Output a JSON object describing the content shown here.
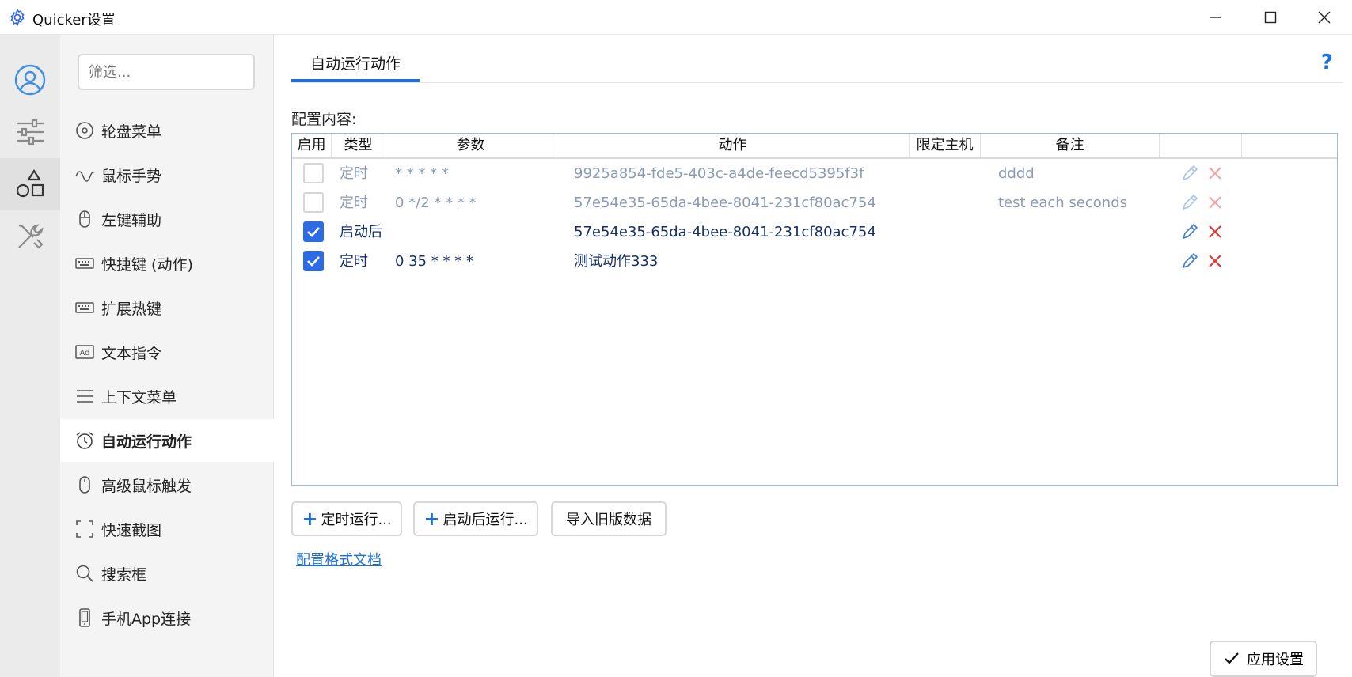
{
  "window": {
    "title": "Quicker设置"
  },
  "rail": {
    "items": [
      {
        "icon": "user-icon"
      },
      {
        "icon": "sliders-icon"
      },
      {
        "icon": "shapes-icon"
      },
      {
        "icon": "tools-icon"
      }
    ]
  },
  "nav": {
    "filter_placeholder": "筛选...",
    "items": [
      {
        "label": "轮盘菜单",
        "icon": "circle-dot-icon"
      },
      {
        "label": "鼠标手势",
        "icon": "wave-icon"
      },
      {
        "label": "左键辅助",
        "icon": "mouse-icon"
      },
      {
        "label": "快捷键 (动作)",
        "icon": "keyboard-icon"
      },
      {
        "label": "扩展热键",
        "icon": "keyboard-icon"
      },
      {
        "label": "文本指令",
        "icon": "ad-text-icon"
      },
      {
        "label": "上下文菜单",
        "icon": "menu-lines-icon"
      },
      {
        "label": "自动运行动作",
        "icon": "alarm-clock-icon",
        "active": true
      },
      {
        "label": "高级鼠标触发",
        "icon": "mouse-icon"
      },
      {
        "label": "快速截图",
        "icon": "screenshot-icon"
      },
      {
        "label": "搜索框",
        "icon": "search-icon"
      },
      {
        "label": "手机App连接",
        "icon": "phone-icon"
      }
    ]
  },
  "main": {
    "tab_label": "自动运行动作",
    "help": "?",
    "section_label": "配置内容:",
    "columns": [
      "启用",
      "类型",
      "参数",
      "动作",
      "限定主机",
      "备注"
    ],
    "rows": [
      {
        "enabled": false,
        "type": "定时",
        "params": "* * * * *",
        "action": "9925a854-fde5-403c-a4de-feecd5395f3f",
        "host": "",
        "note": "dddd"
      },
      {
        "enabled": false,
        "type": "定时",
        "params": "0 */2 * * * *",
        "action": "57e54e35-65da-4bee-8041-231cf80ac754",
        "host": "",
        "note": "test each seconds"
      },
      {
        "enabled": true,
        "type": "启动后",
        "params": "",
        "action": "57e54e35-65da-4bee-8041-231cf80ac754",
        "host": "",
        "note": ""
      },
      {
        "enabled": true,
        "type": "定时",
        "params": "0 35 * * * *",
        "action": "测试动作333",
        "host": "",
        "note": ""
      }
    ],
    "buttons": {
      "add_timer": "定时运行...",
      "add_startup": "启动后运行...",
      "import_old": "导入旧版数据"
    },
    "doc_link": "配置格式文档",
    "apply": "应用设置"
  },
  "colors": {
    "accent": "#1e6fd9",
    "checkbox": "#2d6be4",
    "delete": "#e53935",
    "edit": "#3a7bd5"
  }
}
